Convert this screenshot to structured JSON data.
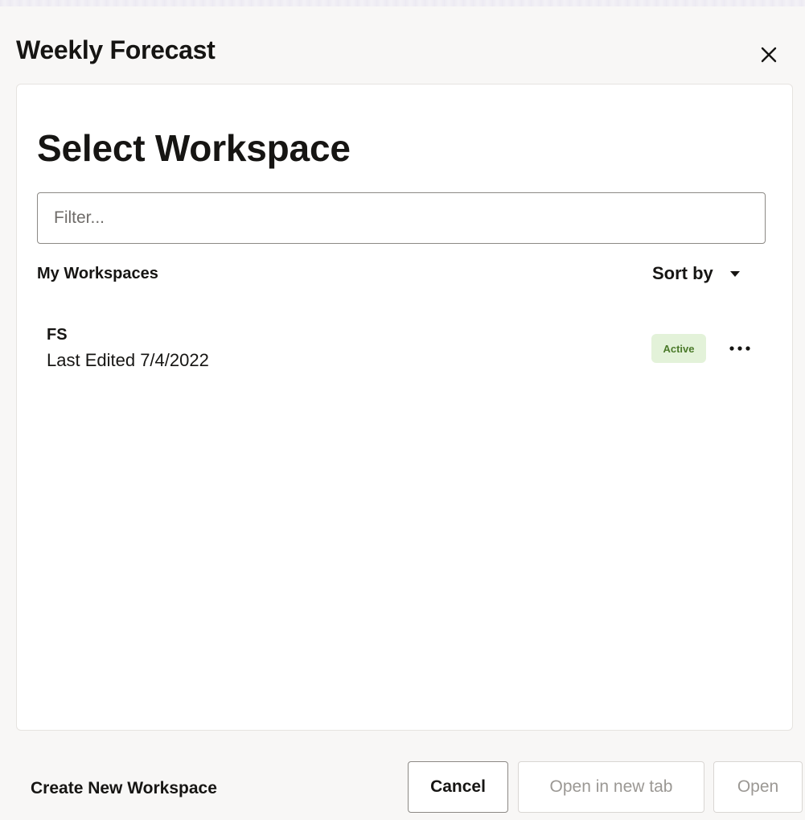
{
  "dialog": {
    "title": "Weekly Forecast",
    "close_icon": "close-icon"
  },
  "panel": {
    "title": "Select Workspace",
    "filter": {
      "value": "",
      "placeholder": "Filter..."
    },
    "section_label": "My Workspaces",
    "sort": {
      "label": "Sort by",
      "icon": "caret-down-icon"
    },
    "workspaces": [
      {
        "name": "FS",
        "meta": "Last Edited 7/4/2022",
        "status": "Active",
        "more_icon": "more-horizontal-icon"
      }
    ]
  },
  "footer": {
    "create_label": "Create New Workspace",
    "cancel_label": "Cancel",
    "open_new_tab_label": "Open in new tab",
    "open_label": "Open"
  },
  "colors": {
    "background": "#f8f7f6",
    "panel": "#ffffff",
    "text": "#161513",
    "active_badge_bg": "#e3f2d9",
    "active_badge_text": "#4b7a2a",
    "disabled_text": "#9b9894"
  }
}
